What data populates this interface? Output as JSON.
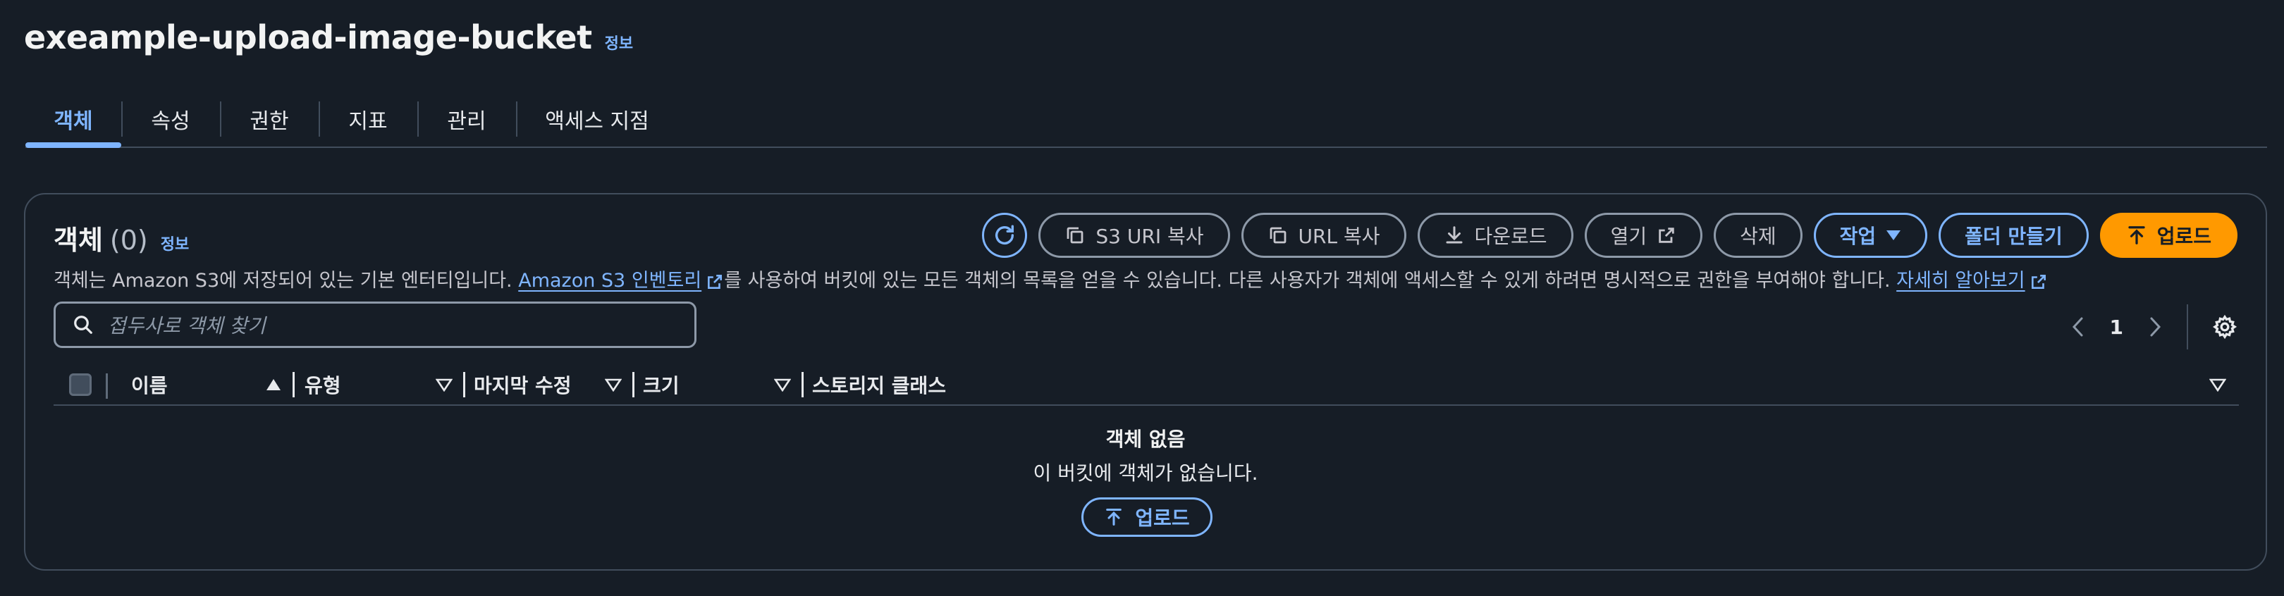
{
  "header": {
    "title": "exeample-upload-image-bucket",
    "info": "정보"
  },
  "tabs": [
    {
      "label": "객체",
      "active": true
    },
    {
      "label": "속성"
    },
    {
      "label": "권한"
    },
    {
      "label": "지표"
    },
    {
      "label": "관리"
    },
    {
      "label": "액세스 지점"
    }
  ],
  "objects": {
    "title": "객체",
    "count": "(0)",
    "info": "정보",
    "toolbar": {
      "refresh_icon": "refresh-icon",
      "copy_s3_uri": "S3 URI 복사",
      "copy_url": "URL 복사",
      "download": "다운로드",
      "open": "열기",
      "delete": "삭제",
      "actions": "작업",
      "create_folder": "폴더 만들기",
      "upload": "업로드"
    },
    "description": {
      "part1": "객체는 Amazon S3에 저장되어 있는 기본 엔터티입니다. ",
      "inventory_link": "Amazon S3 인벤토리",
      "part2": "를 사용하여 버킷에 있는 모든 객체의 목록을 얻을 수 있습니다. 다른 사용자가 객체에 액세스할 수 있게 하려면 명시적으로 권한을 부여해야 합니다. ",
      "learn_more": "자세히 알아보기"
    },
    "search": {
      "placeholder": "접두사로 객체 찾기"
    },
    "pagination": {
      "page": "1"
    },
    "columns": [
      "이름",
      "유형",
      "마지막 수정",
      "크기",
      "스토리지 클래스"
    ],
    "empty": {
      "title": "객체 없음",
      "message": "이 버킷에 객체가 없습니다.",
      "upload": "업로드"
    }
  },
  "colors": {
    "background": "#161d26",
    "link": "#7fb5ff",
    "primary": "#ff9900",
    "border": "#414d5c"
  }
}
